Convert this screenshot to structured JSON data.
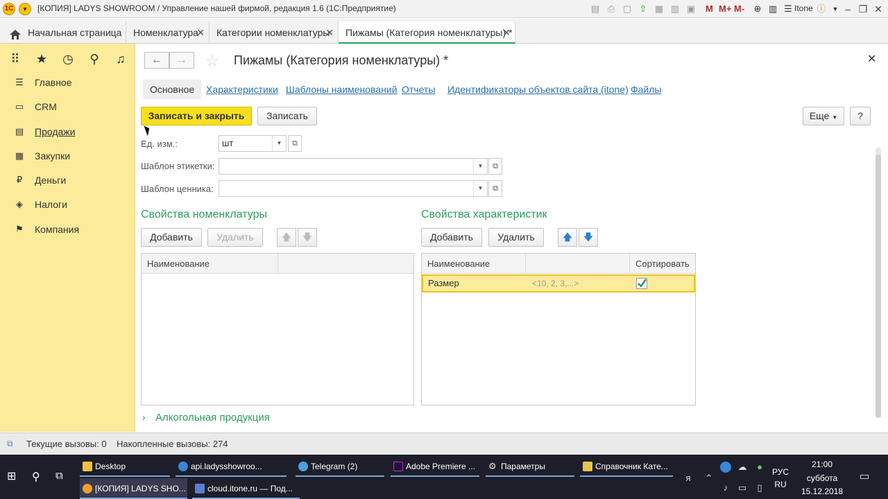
{
  "window": {
    "title": "[КОПИЯ] LADYS SHOWROOM / Управление нашей фирмой, редакция 1.6  (1С:Предприятие)",
    "user": "Itone",
    "m_buttons": [
      "M",
      "M+",
      "M-"
    ]
  },
  "tabs": [
    {
      "label": "Начальная страница"
    },
    {
      "label": "Номенклатура"
    },
    {
      "label": "Категории номенклатуры"
    },
    {
      "label": "Пижамы (Категория номенклатуры) *"
    }
  ],
  "sidebar": {
    "items": [
      {
        "label": "Главное",
        "icon": "menu-icon"
      },
      {
        "label": "CRM",
        "icon": "crm-icon"
      },
      {
        "label": "Продажи",
        "icon": "cart-icon"
      },
      {
        "label": "Закупки",
        "icon": "truck-icon"
      },
      {
        "label": "Деньги",
        "icon": "money-icon"
      },
      {
        "label": "Налоги",
        "icon": "tax-icon"
      },
      {
        "label": "Компания",
        "icon": "flag-icon"
      }
    ]
  },
  "form": {
    "title": "Пижамы (Категория номенклатуры) *",
    "subtabs": [
      "Основное",
      "Характеристики",
      "Шаблоны наименований",
      "Отчеты",
      "Идентификаторы объектов сайта (itone)",
      "Файлы"
    ],
    "buttons": {
      "save_close": "Записать и закрыть",
      "save": "Записать",
      "more": "Еще",
      "help": "?"
    },
    "fields": {
      "unit_label": "Ед. изм.:",
      "unit_value": "шт",
      "label_template_label": "Шаблон этикетки:",
      "label_template_value": "",
      "price_template_label": "Шаблон ценника:",
      "price_template_value": ""
    },
    "props_left": {
      "title": "Свойства номенклатуры",
      "add": "Добавить",
      "delete": "Удалить",
      "col_name": "Наименование"
    },
    "props_right": {
      "title": "Свойства характеристик",
      "add": "Добавить",
      "delete": "Удалить",
      "col_name": "Наименование",
      "col_sort": "Сортировать",
      "rows": [
        {
          "name": "Размер",
          "values": "<10, 2, 3,...>",
          "sort": true
        }
      ]
    },
    "alcohol": "Алкогольная продукция"
  },
  "status": {
    "current_calls": "Текущие вызовы: 0",
    "accum_calls": "Накопленные вызовы: 274"
  },
  "taskbar": {
    "row1": [
      {
        "label": "Desktop",
        "color": "#f0c040"
      },
      {
        "label": "api.ladysshowroo...",
        "color": "#3a86d8"
      },
      {
        "label": "Telegram (2)",
        "color": "#4aa0e0"
      },
      {
        "label": "Adobe Premiere ...",
        "color": "#9b3fbf"
      },
      {
        "label": "Параметры",
        "color": "#dddddd"
      },
      {
        "label": "Справочник Кате...",
        "color": "#e8c34a"
      }
    ],
    "row2": [
      {
        "label": "[КОПИЯ] LADYS SHO...",
        "color": "#f0a030"
      },
      {
        "label": "cloud.itone.ru — Под...",
        "color": "#5a7fd0"
      }
    ],
    "lang_top": "РУС",
    "lang_bottom": "RU",
    "time": "21:00",
    "day": "суббота",
    "date": "15.12.2018"
  }
}
